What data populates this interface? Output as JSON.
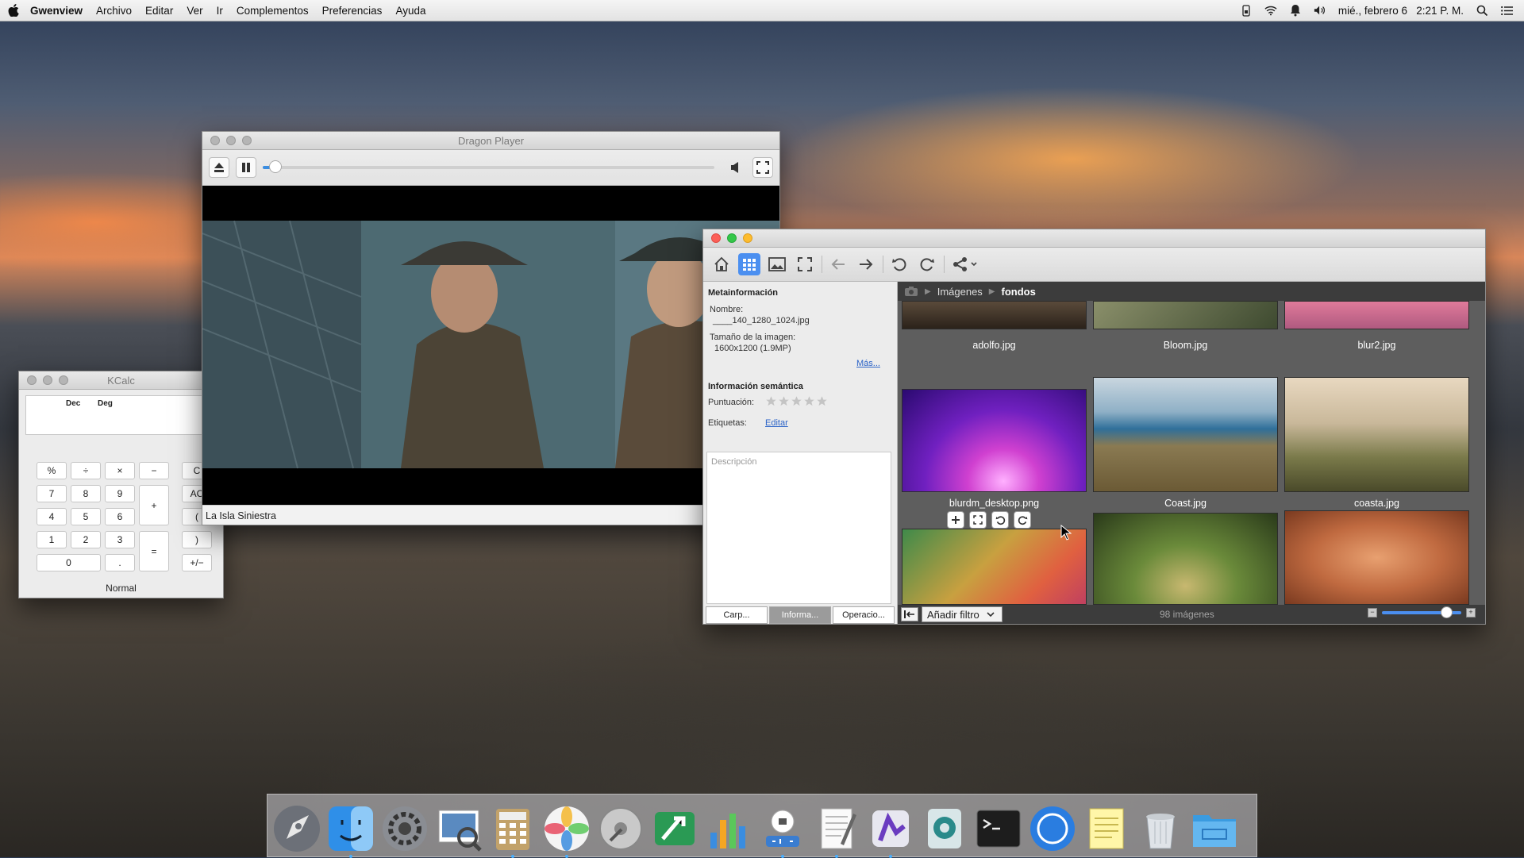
{
  "menubar": {
    "app": "Gwenview",
    "items": [
      "Archivo",
      "Editar",
      "Ver",
      "Ir",
      "Complementos",
      "Preferencias",
      "Ayuda"
    ],
    "clock": "mié., febrero 6   2:21 P. M."
  },
  "kcalc": {
    "title": "KCalc",
    "labels": [
      "Dec",
      "Deg"
    ],
    "buttons": [
      "%",
      "÷",
      "×",
      "−",
      "C",
      "7",
      "8",
      "9",
      "+",
      "AC",
      "4",
      "5",
      "6",
      "(",
      "1",
      "2",
      "3",
      "=",
      ")",
      "0",
      ".",
      "+/−"
    ],
    "mode": "Normal"
  },
  "dragon": {
    "title": "Dragon Player",
    "caption": "La Isla Siniestra"
  },
  "gwenview": {
    "sidebar": {
      "meta_heading": "Metainformación",
      "name_key": "Nombre:",
      "name_value": "____140_1280_1024.jpg",
      "size_key": "Tamaño de la imagen:",
      "size_value": "1600x1200 (1.9MP)",
      "more_link": "Más...",
      "semantic_heading": "Información semántica",
      "rating_key": "Puntuación:",
      "rating_value": 0,
      "tags_key": "Etiquetas:",
      "tags_link": "Editar",
      "description_placeholder": "Descripción",
      "tabs": [
        "Carp...",
        "Informa...",
        "Operacio..."
      ]
    },
    "breadcrumb": [
      "Imágenes",
      "fondos"
    ],
    "thumbnails": [
      "adolfo.jpg",
      "Bloom.jpg",
      "blur2.jpg",
      "blurdm_desktop.png",
      "Coast.jpg",
      "coasta.jpg"
    ],
    "filter_button": "Añadir filtro",
    "image_count": "98 imágenes"
  },
  "dock": {
    "apps": [
      "launchpad-icon",
      "finder-icon",
      "system-preferences-icon",
      "preview-icon",
      "calculator-icon",
      "photos-icon",
      "disk-utility-icon",
      "xcode-icon",
      "numbers-icon",
      "sound-icon",
      "textedit-icon",
      "kde-app-icon",
      "gimp-icon",
      "terminal-icon",
      "browser-icon",
      "notes-icon",
      "trash-icon",
      "folder-icon"
    ]
  },
  "colors": {
    "accent": "#4b8ff0",
    "link": "#2b63c7",
    "traffic_red": "#fc5f57",
    "traffic_yellow": "#fdbc2e",
    "traffic_green": "#34c749"
  }
}
